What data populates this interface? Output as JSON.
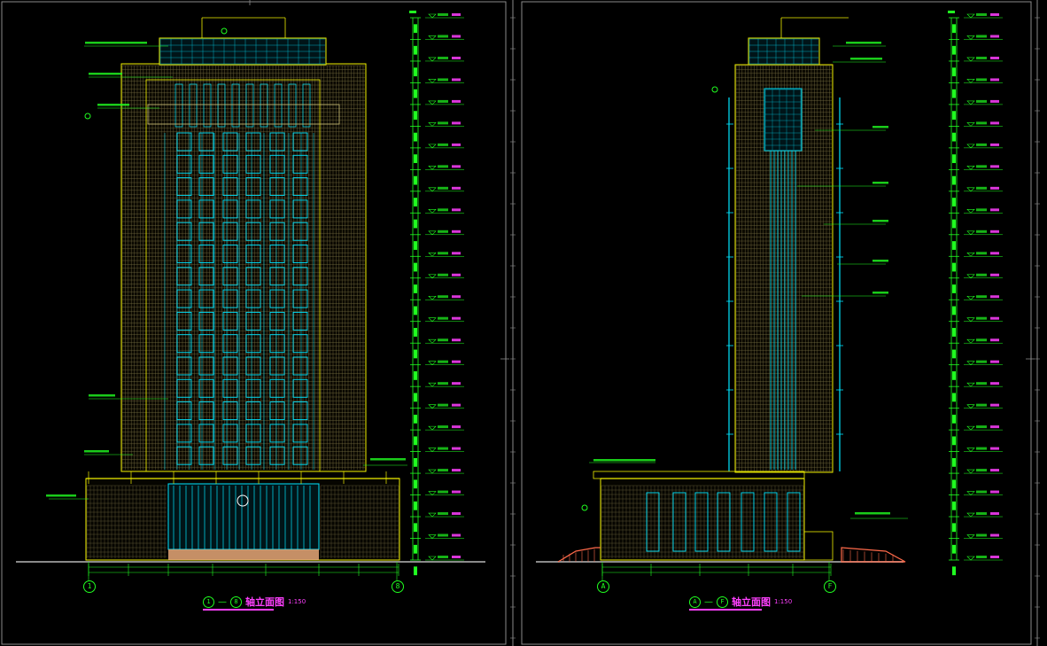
{
  "colors": {
    "background": "#000000",
    "frame": "#8a8a8a",
    "outline": "#f0f000",
    "glass": "#00e5ff",
    "grid": "#cfc27a",
    "annotation": "#20ff20",
    "title": "#ff40ff",
    "ground": "#8a8a8a",
    "entrance": "#e8a878",
    "stair": "#ff6a4a"
  },
  "left_elevation": {
    "axis_start": "1",
    "axis_end": "8",
    "title_symbol_start": "1",
    "title_symbol_end": "8",
    "title": "轴立面图",
    "scale": "1:150"
  },
  "right_elevation": {
    "axis_start": "A",
    "axis_end": "F",
    "title_symbol_start": "A",
    "title_symbol_end": "F",
    "title": "轴立面图",
    "scale": "1:150"
  },
  "icons": {
    "axis_marker": "axis-circle-icon",
    "level_marker": "level-triangle-icon"
  }
}
